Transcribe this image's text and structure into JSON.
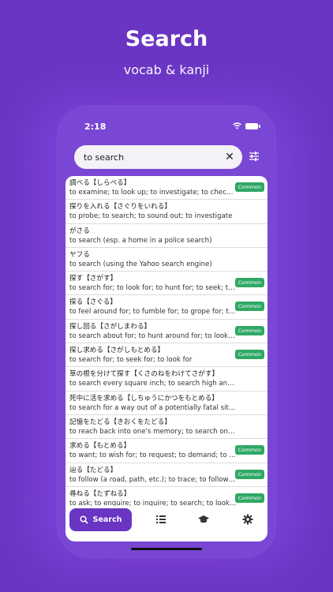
{
  "promo": {
    "title": "Search",
    "subtitle": "vocab & kanji"
  },
  "status": {
    "time": "2:18"
  },
  "search": {
    "value": "to search",
    "clear_icon": "close-icon",
    "filter_icon": "sliders-icon"
  },
  "results": [
    {
      "word": "調べる【しらべる】",
      "gloss": "to examine; to look up; to investigate; to check up; to...",
      "badge": "Common"
    },
    {
      "word": "探りを入れる【さぐりをいれる】",
      "gloss": "to probe; to search; to sound out; to investigate",
      "badge": ""
    },
    {
      "word": "がさる",
      "gloss": "to search (esp. a home in a police search)",
      "badge": ""
    },
    {
      "word": "ヤフる",
      "gloss": "to search (using the Yahoo search engine)",
      "badge": ""
    },
    {
      "word": "探す【さがす】",
      "gloss": "to search for; to look for; to hunt for; to seek; to se...",
      "badge": "Common"
    },
    {
      "word": "探る【さぐる】",
      "gloss": "to feel around for; to fumble for; to grope for; to se...",
      "badge": "Common"
    },
    {
      "word": "探し回る【さがしまわる】",
      "gloss": "to search about for; to hunt around for; to look hig...",
      "badge": "Common"
    },
    {
      "word": "探し求める【さがしもとめる】",
      "gloss": "to search for; to seek for; to look for",
      "badge": "Common"
    },
    {
      "word": "草の根を分けて探す【くさのねをわけてさがす】",
      "gloss": "to search every square inch; to search high and low",
      "badge": ""
    },
    {
      "word": "死中に活を求める【しちゅうにかつをもとめる】",
      "gloss": "to search for a way out of a potentially fatal situation; to se...",
      "badge": ""
    },
    {
      "word": "記憶をたどる【きおくをたどる】",
      "gloss": "to reach back into one's memory; to search one's mind; to r...",
      "badge": ""
    },
    {
      "word": "求める【もとめる】",
      "gloss": "to want; to wish for; to request; to demand; to req...",
      "badge": "Common"
    },
    {
      "word": "辿る【たどる】",
      "gloss": "to follow (a road, path, etc.); to trace; to follow (a c...",
      "badge": "Common"
    },
    {
      "word": "尋ねる【たずねる】",
      "gloss": "to ask; to enquire; to inquire; to search; to look for...",
      "badge": "Common"
    }
  ],
  "tabbar": {
    "search_label": "Search",
    "search_icon": "search-icon",
    "list_icon": "list-icon",
    "learn_icon": "graduation-cap-icon",
    "settings_icon": "gear-icon"
  },
  "colors": {
    "accent": "#6a35c2",
    "badge": "#2fa865"
  }
}
